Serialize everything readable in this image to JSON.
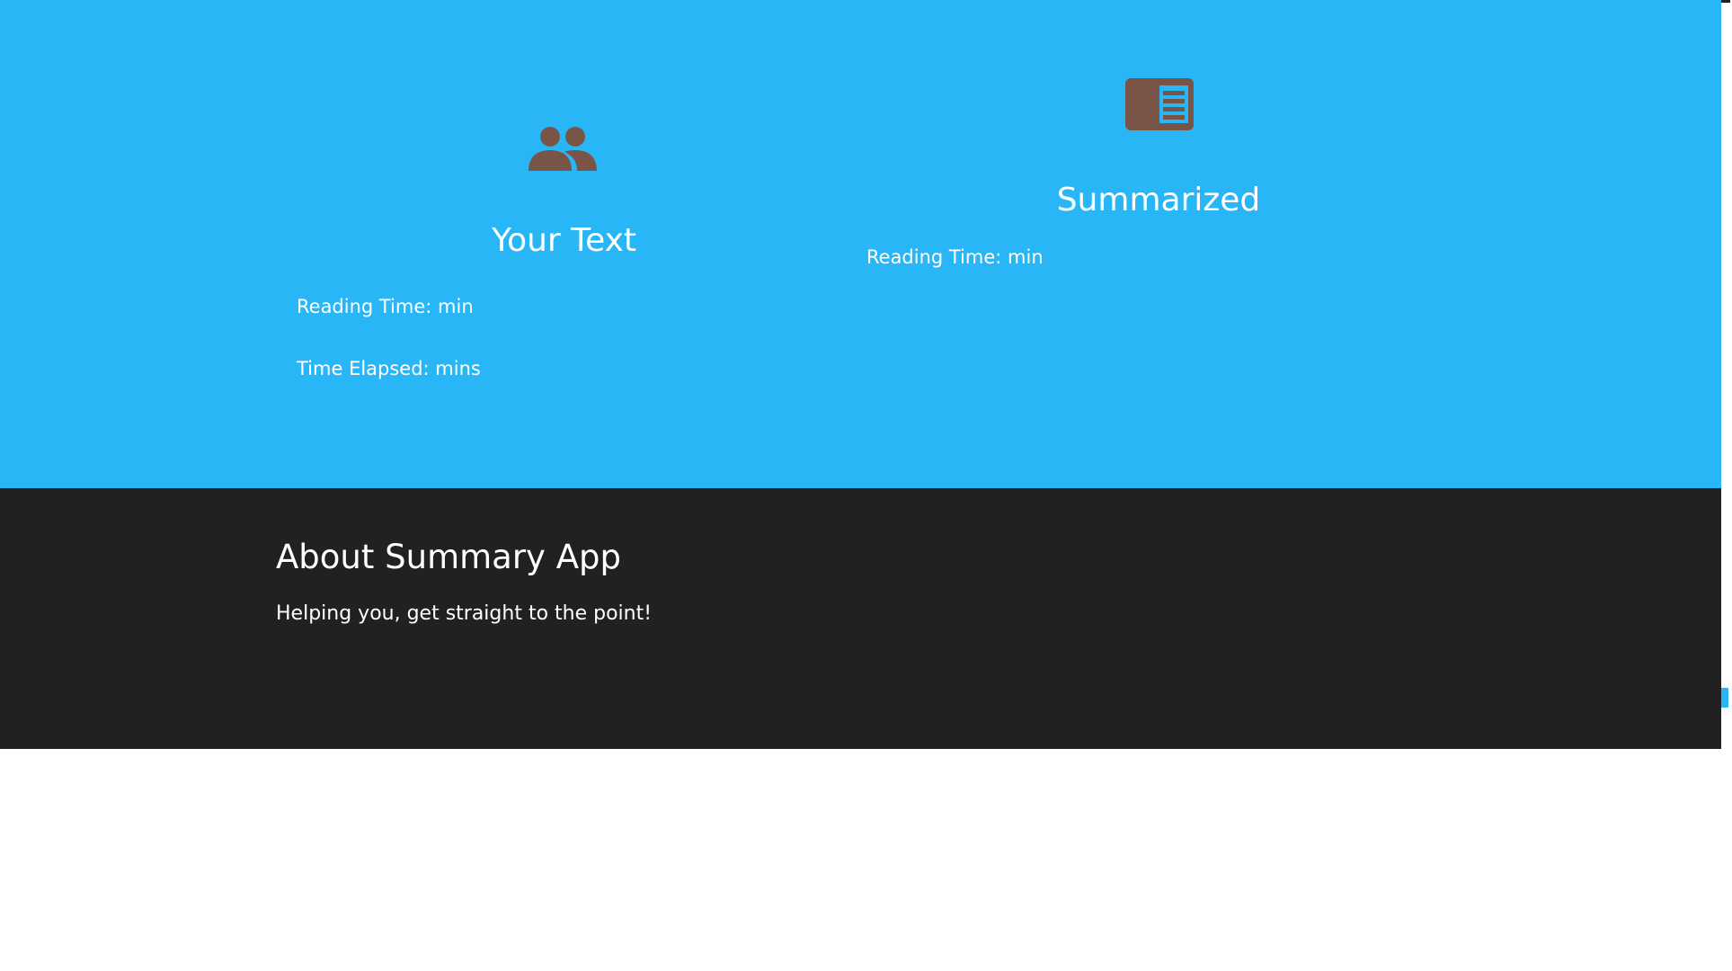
{
  "colors": {
    "hero_bg": "#29b6f6",
    "footer_bg": "#212121",
    "icon": "#795548",
    "text": "#ffffff"
  },
  "your_text": {
    "icon": "group-icon",
    "title": "Your Text",
    "reading_time": "Reading Time: min",
    "time_elapsed": "Time Elapsed: mins"
  },
  "summarized": {
    "icon": "chrome-reader-mode-icon",
    "title": "Summarized",
    "reading_time": "Reading Time: min"
  },
  "footer": {
    "title": "About Summary App",
    "tagline": "Helping you, get straight to the point!"
  }
}
